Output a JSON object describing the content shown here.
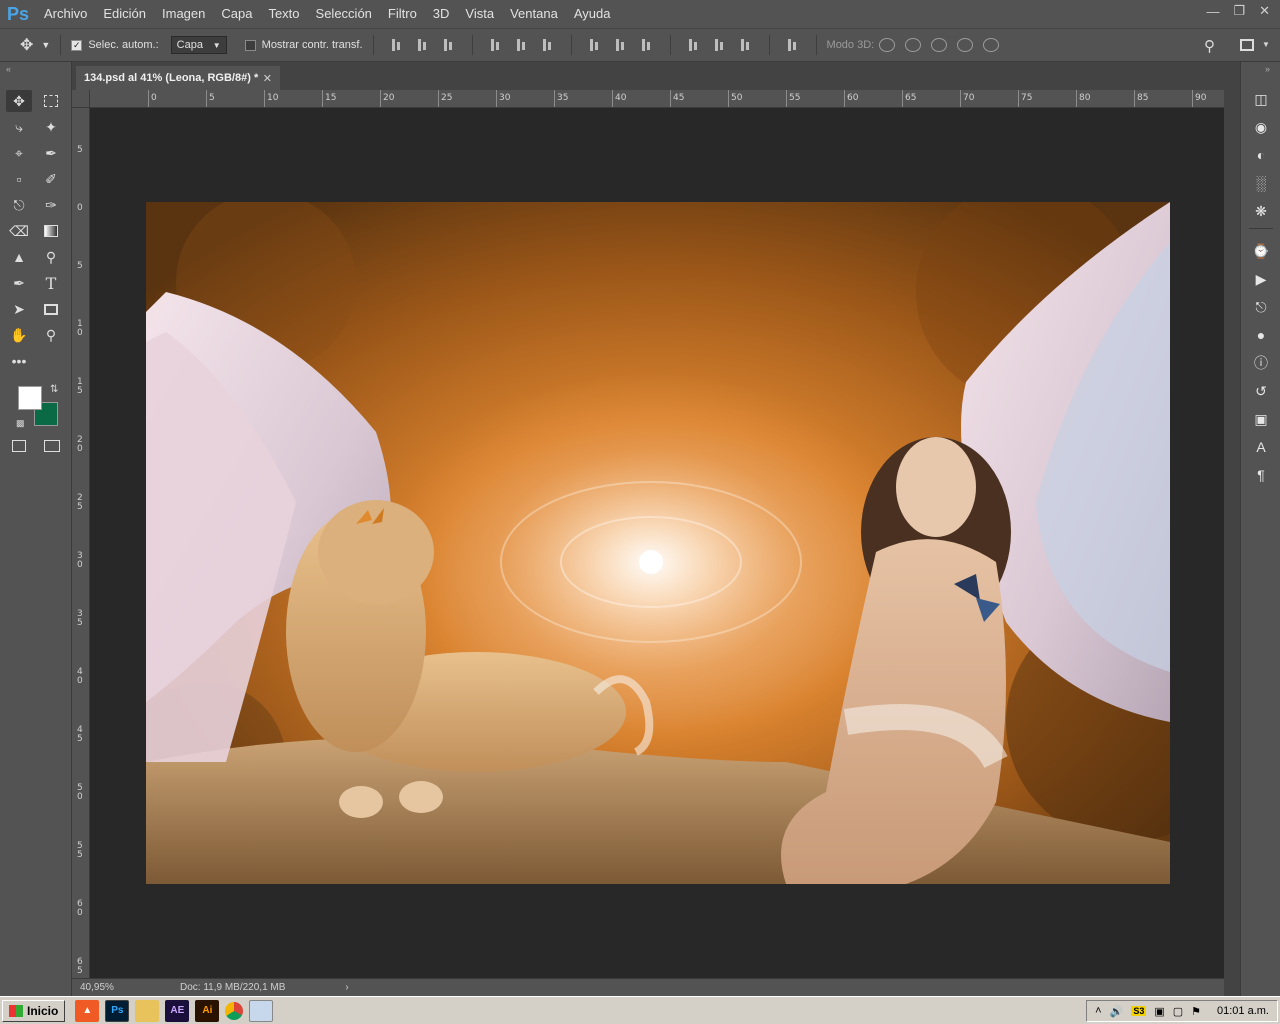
{
  "app": {
    "logo": "Ps",
    "menu": [
      "Archivo",
      "Edición",
      "Imagen",
      "Capa",
      "Texto",
      "Selección",
      "Filtro",
      "3D",
      "Vista",
      "Ventana",
      "Ayuda"
    ],
    "window_controls": [
      "minimize-icon",
      "restore-icon",
      "close-icon"
    ]
  },
  "options": {
    "auto_select_label": "Selec. autom.:",
    "auto_select_checked": true,
    "auto_select_target": "Capa",
    "show_transform_label": "Mostrar contr. transf.",
    "show_transform_checked": false,
    "mode_3d_label": "Modo 3D:"
  },
  "document": {
    "tab_title": "134.psd al 41% (Leona, RGB/8#) *",
    "zoom": "40,95%",
    "doc_info": "Doc: 11,9 MB/220,1 MB"
  },
  "ruler": {
    "h_labels": [
      "0",
      "5",
      "10",
      "15",
      "20",
      "25",
      "30",
      "35",
      "40",
      "45",
      "50",
      "55",
      "60",
      "65",
      "70",
      "75",
      "80",
      "85",
      "90"
    ],
    "v_labels": [
      "5",
      "0",
      "5",
      "10",
      "15",
      "20",
      "25",
      "30",
      "35",
      "40",
      "45",
      "50",
      "55",
      "60",
      "65"
    ]
  },
  "colors": {
    "foreground": "#ffffff",
    "background": "#0b6a46",
    "accent": "#4aa5e8"
  },
  "taskbar": {
    "start_label": "Inicio",
    "apps": [
      "brave-icon",
      "photoshop-icon",
      "explorer-icon",
      "after-effects-icon",
      "illustrator-icon",
      "chrome-icon",
      "paint-icon"
    ],
    "app_labels": {
      "ps": "Ps",
      "ae": "AE",
      "ai": "Ai"
    },
    "tray_badge": "S3",
    "clock": "01:01 a.m."
  }
}
